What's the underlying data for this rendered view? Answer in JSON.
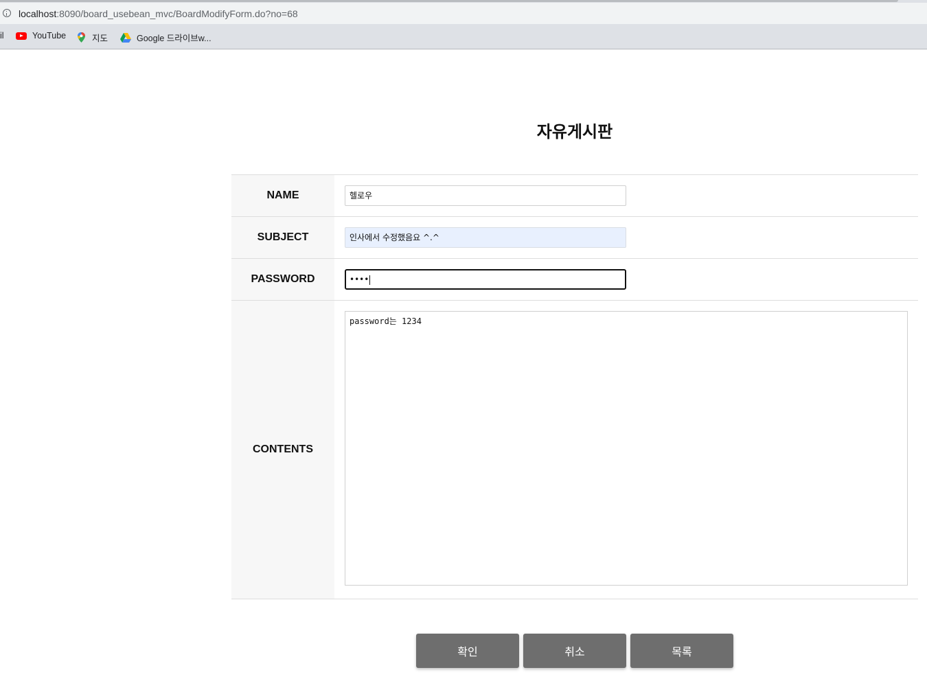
{
  "browser": {
    "url_host": "localhost",
    "url_rest": ":8090/board_usebean_mvc/BoardModifyForm.do?no=68",
    "bookmarks": {
      "cut_label": "il",
      "youtube": "YouTube",
      "maps": "지도",
      "drive": "Google 드라이브w..."
    }
  },
  "page": {
    "title": "자유게시판"
  },
  "form": {
    "name": {
      "label": "NAME",
      "value": "헬로우"
    },
    "subject": {
      "label": "SUBJECT",
      "value": "인사에서 수정했음요 ^.^"
    },
    "password": {
      "label": "PASSWORD",
      "value": "••••"
    },
    "contents": {
      "label": "CONTENTS",
      "value": "password는 1234"
    }
  },
  "buttons": {
    "confirm": "확인",
    "cancel": "취소",
    "list": "목록"
  },
  "colors": {
    "button_bg": "#6e6e6e",
    "label_bg": "#f7f7f7",
    "autofill_bg": "#e8f0fe"
  }
}
